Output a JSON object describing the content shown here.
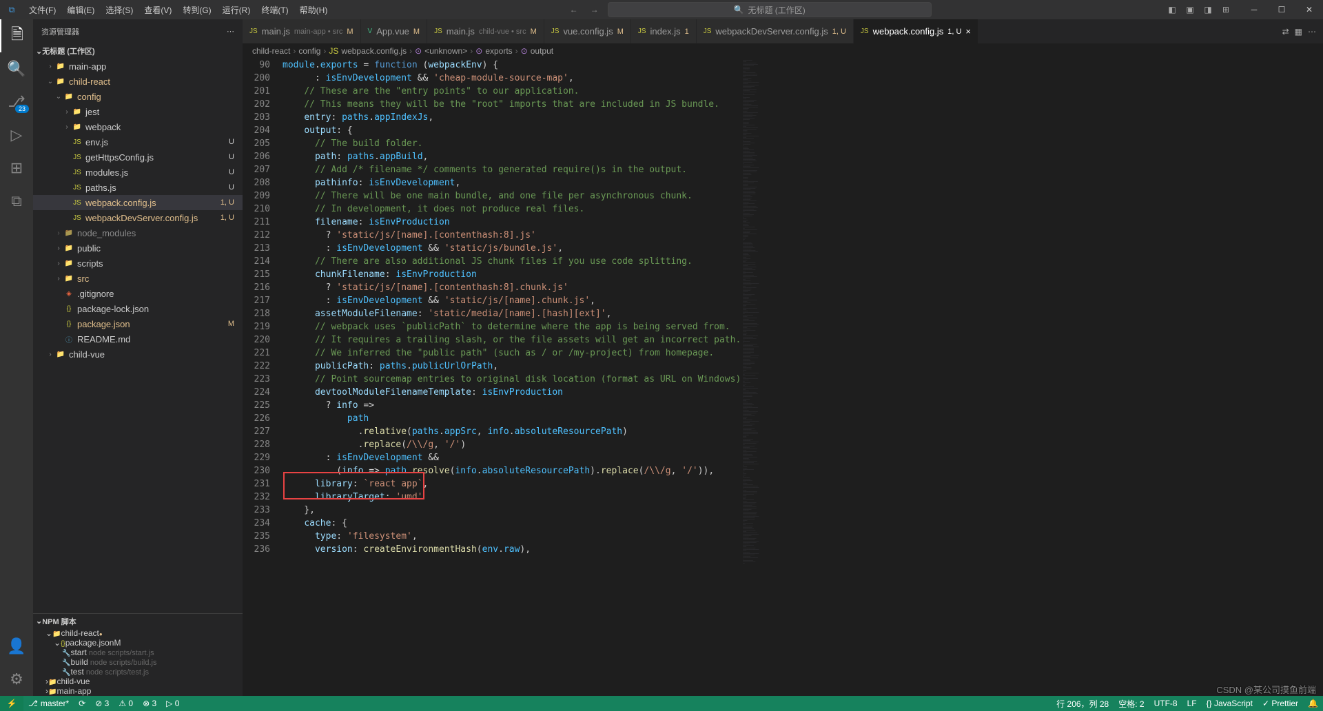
{
  "title_prefix": "无标题 (工作区)",
  "menu": [
    "文件(F)",
    "编辑(E)",
    "选择(S)",
    "查看(V)",
    "转到(G)",
    "运行(R)",
    "终端(T)",
    "帮助(H)"
  ],
  "activity_badge": "23",
  "sidebar_title": "资源管理器",
  "workspace_root": "无标题 (工作区)",
  "tree": [
    {
      "label": "main-app",
      "kind": "folder",
      "depth": 1,
      "open": false
    },
    {
      "label": "child-react",
      "kind": "folder",
      "depth": 1,
      "open": true,
      "modcolor": true
    },
    {
      "label": "config",
      "kind": "folder",
      "depth": 2,
      "open": true,
      "modcolor": true
    },
    {
      "label": "jest",
      "kind": "folder",
      "depth": 3,
      "open": false
    },
    {
      "label": "webpack",
      "kind": "folder",
      "depth": 3,
      "open": false
    },
    {
      "label": "env.js",
      "kind": "js",
      "depth": 3,
      "status": "U"
    },
    {
      "label": "getHttpsConfig.js",
      "kind": "js",
      "depth": 3,
      "status": "U"
    },
    {
      "label": "modules.js",
      "kind": "js",
      "depth": 3,
      "status": "U"
    },
    {
      "label": "paths.js",
      "kind": "js",
      "depth": 3,
      "status": "U"
    },
    {
      "label": "webpack.config.js",
      "kind": "js",
      "depth": 3,
      "status": "1, U",
      "active": true,
      "modcolor": true
    },
    {
      "label": "webpackDevServer.config.js",
      "kind": "js",
      "depth": 3,
      "status": "1, U",
      "modcolor": true
    },
    {
      "label": "node_modules",
      "kind": "folder",
      "depth": 2,
      "open": false,
      "dim": true
    },
    {
      "label": "public",
      "kind": "folder",
      "depth": 2,
      "open": false
    },
    {
      "label": "scripts",
      "kind": "folder",
      "depth": 2,
      "open": false
    },
    {
      "label": "src",
      "kind": "folder",
      "depth": 2,
      "open": false,
      "modcolor": true
    },
    {
      "label": ".gitignore",
      "kind": "git",
      "depth": 2
    },
    {
      "label": "package-lock.json",
      "kind": "json",
      "depth": 2
    },
    {
      "label": "package.json",
      "kind": "json",
      "depth": 2,
      "status": "M",
      "modcolor": true
    },
    {
      "label": "README.md",
      "kind": "md",
      "depth": 2
    },
    {
      "label": "child-vue",
      "kind": "folder",
      "depth": 1,
      "open": false
    }
  ],
  "npm_title": "NPM 脚本",
  "npm": [
    {
      "label": "child-react",
      "kind": "folder",
      "depth": 0,
      "open": true,
      "dot": true
    },
    {
      "label": "package.json",
      "kind": "json",
      "depth": 1,
      "open": true,
      "status": "M"
    },
    {
      "label": "start",
      "desc": "node scripts/start.js",
      "kind": "script",
      "depth": 2
    },
    {
      "label": "build",
      "desc": "node scripts/build.js",
      "kind": "script",
      "depth": 2
    },
    {
      "label": "test",
      "desc": "node scripts/test.js",
      "kind": "script",
      "depth": 2
    },
    {
      "label": "child-vue",
      "kind": "folder",
      "depth": 0,
      "open": false
    },
    {
      "label": "main-app",
      "kind": "folder",
      "depth": 0,
      "open": false
    }
  ],
  "tabs": [
    {
      "label": "main.js",
      "icon": "js",
      "desc": "main-app • src",
      "dirty": "M"
    },
    {
      "label": "App.vue",
      "icon": "vue",
      "dirty": "M"
    },
    {
      "label": "main.js",
      "icon": "js",
      "desc": "child-vue • src",
      "dirty": "M"
    },
    {
      "label": "vue.config.js",
      "icon": "js",
      "dirty": "M"
    },
    {
      "label": "index.js",
      "icon": "js",
      "dirty": "1"
    },
    {
      "label": "webpackDevServer.config.js",
      "icon": "js",
      "dirty": "1, U"
    },
    {
      "label": "webpack.config.js",
      "icon": "js",
      "dirty": "1, U",
      "active": true,
      "close": true
    }
  ],
  "breadcrumb": [
    "child-react",
    "config",
    "webpack.config.js",
    "<unknown>",
    "exports",
    "output"
  ],
  "code": [
    {
      "n": 90,
      "html": "<span class='n'>module</span>.<span class='n'>exports</span> <span class='o'>=</span> <span class='k'>function</span> (<span class='p'>webpackEnv</span>) {"
    },
    {
      "n": 200,
      "html": "      : <span class='n'>isEnvDevelopment</span> <span class='o'>&amp;&amp;</span> <span class='s'>'cheap-module-source-map'</span>,"
    },
    {
      "n": 201,
      "html": "    <span class='c'>// These are the \"entry points\" to our application.</span>"
    },
    {
      "n": 202,
      "html": "    <span class='c'>// This means they will be the \"root\" imports that are included in JS bundle.</span>"
    },
    {
      "n": 203,
      "html": "    <span class='p'>entry</span>: <span class='n'>paths</span>.<span class='n'>appIndexJs</span>,"
    },
    {
      "n": 204,
      "html": "    <span class='p'>output</span>: {"
    },
    {
      "n": 205,
      "html": "      <span class='c'>// The build folder.</span>"
    },
    {
      "n": 206,
      "html": "      <span class='p'>path</span>: <span class='n'>paths</span>.<span class='n'>appBuild</span>,"
    },
    {
      "n": 207,
      "html": "      <span class='c'>// Add /* filename */ comments to generated require()s in the output.</span>"
    },
    {
      "n": 208,
      "html": "      <span class='p'>pathinfo</span>: <span class='n'>isEnvDevelopment</span>,"
    },
    {
      "n": 209,
      "html": "      <span class='c'>// There will be one main bundle, and one file per asynchronous chunk.</span>"
    },
    {
      "n": 210,
      "html": "      <span class='c'>// In development, it does not produce real files.</span>"
    },
    {
      "n": 211,
      "html": "      <span class='p'>filename</span>: <span class='n'>isEnvProduction</span>"
    },
    {
      "n": 212,
      "html": "        ? <span class='s'>'static/js/[name].[contenthash:8].js'</span>"
    },
    {
      "n": 213,
      "html": "        : <span class='n'>isEnvDevelopment</span> <span class='o'>&amp;&amp;</span> <span class='s'>'static/js/bundle.js'</span>,"
    },
    {
      "n": 214,
      "html": "      <span class='c'>// There are also additional JS chunk files if you use code splitting.</span>"
    },
    {
      "n": 215,
      "html": "      <span class='p'>chunkFilename</span>: <span class='n'>isEnvProduction</span>"
    },
    {
      "n": 216,
      "html": "        ? <span class='s'>'static/js/[name].[contenthash:8].chunk.js'</span>"
    },
    {
      "n": 217,
      "html": "        : <span class='n'>isEnvDevelopment</span> <span class='o'>&amp;&amp;</span> <span class='s'>'static/js/[name].chunk.js'</span>,"
    },
    {
      "n": 218,
      "html": "      <span class='p'>assetModuleFilename</span>: <span class='s'>'static/media/[name].[hash][ext]'</span>,"
    },
    {
      "n": 219,
      "html": "      <span class='c'>// webpack uses `publicPath` to determine where the app is being served from.</span>"
    },
    {
      "n": 220,
      "html": "      <span class='c'>// It requires a trailing slash, or the file assets will get an incorrect path.</span>"
    },
    {
      "n": 221,
      "html": "      <span class='c'>// We inferred the \"public path\" (such as / or /my-project) from homepage.</span>"
    },
    {
      "n": 222,
      "html": "      <span class='p'>publicPath</span>: <span class='n'>paths</span>.<span class='n'>publicUrlOrPath</span>,"
    },
    {
      "n": 223,
      "html": "      <span class='c'>// Point sourcemap entries to original disk location (format as URL on Windows)</span>"
    },
    {
      "n": 224,
      "html": "      <span class='p'>devtoolModuleFilenameTemplate</span>: <span class='n'>isEnvProduction</span>"
    },
    {
      "n": 225,
      "html": "        ? <span class='p'>info</span> <span class='o'>=&gt;</span>"
    },
    {
      "n": 226,
      "html": "            <span class='n'>path</span>"
    },
    {
      "n": 227,
      "html": "              .<span class='f'>relative</span>(<span class='n'>paths</span>.<span class='n'>appSrc</span>, <span class='n'>info</span>.<span class='n'>absoluteResourcePath</span>)"
    },
    {
      "n": 228,
      "html": "              .<span class='f'>replace</span>(<span class='s'>/\\\\/g</span>, <span class='s'>'/'</span>)"
    },
    {
      "n": 229,
      "html": "        : <span class='n'>isEnvDevelopment</span> <span class='o'>&amp;&amp;</span>"
    },
    {
      "n": 230,
      "html": "          (<span class='p'>info</span> <span class='o'>=&gt;</span> <span class='n'>path</span>.<span class='f'>resolve</span>(<span class='n'>info</span>.<span class='n'>absoluteResourcePath</span>).<span class='f'>replace</span>(<span class='s'>/\\\\/g</span>, <span class='s'>'/'</span>)),"
    },
    {
      "n": 231,
      "html": "      <span class='p'>library</span>: <span class='s'>`react app`</span>,"
    },
    {
      "n": 232,
      "html": "      <span class='p'>libraryTarget</span>: <span class='s'>'umd'</span>"
    },
    {
      "n": 233,
      "html": "    },"
    },
    {
      "n": 234,
      "html": "    <span class='p'>cache</span>: {"
    },
    {
      "n": 235,
      "html": "      <span class='p'>type</span>: <span class='s'>'filesystem'</span>,"
    },
    {
      "n": 236,
      "html": "      <span class='p'>version</span>: <span class='f'>createEnvironmentHash</span>(<span class='n'>env</span>.<span class='n'>raw</span>),"
    }
  ],
  "status": {
    "branch": "master*",
    "sync": "⟳",
    "err": "⊘ 3",
    "warn": "⚠ 0",
    "err2": "⊗ 3",
    "play": "▷ 0",
    "pos": "行 206，列 28",
    "spaces": "空格: 2",
    "enc": "UTF-8",
    "eol": "LF",
    "lang": "{} JavaScript",
    "prettier": "✓ Prettier",
    "bell": "🔔"
  },
  "watermark": "CSDN @某公司摸鱼前端"
}
